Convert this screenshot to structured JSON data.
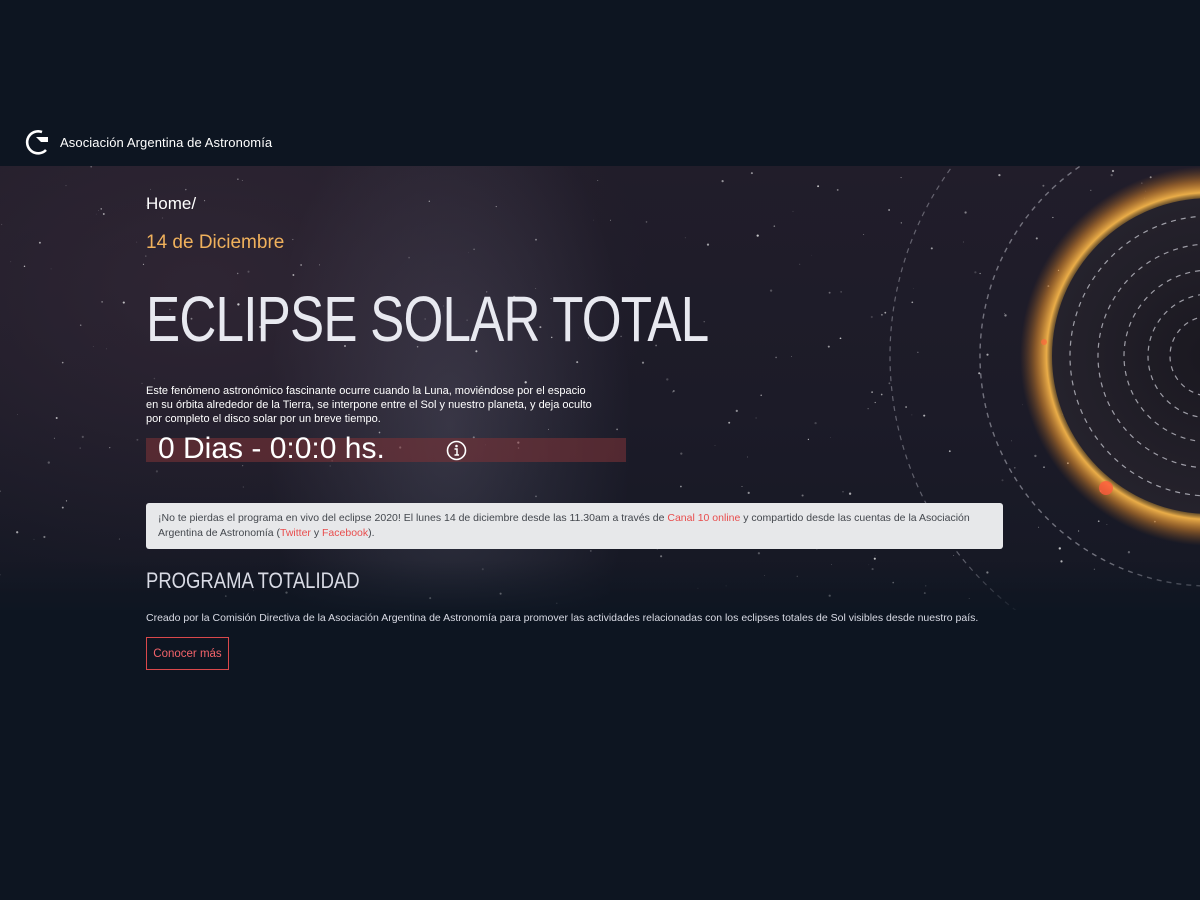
{
  "site": {
    "logo_text": "Asociación Argentina de Astronomía"
  },
  "breadcrumb": {
    "home": "Home",
    "separator": "/"
  },
  "hero": {
    "date": "14 de Diciembre",
    "title": "ECLIPSE SOLAR TOTAL",
    "intro": "Este fenómeno astronómico fascinante ocurre cuando la Luna, moviéndose por el espacio en su órbita alrededor de la Tierra, se interpone entre el Sol y nuestro planeta, y deja oculto por completo el disco solar por un breve tiempo.",
    "countdown": "0 Dias - 0:0:0 hs.",
    "info_icon": "info-circle-icon"
  },
  "notice": {
    "text_before": "¡No te pierdas el programa en vivo del eclipse 2020! El lunes 14 de diciembre desde las 11.30am a través de ",
    "link_canal": "Canal 10 online",
    "text_middle": " y compartido desde las cuentas de la Asociación Argentina de Astronomía (",
    "link_twitter": "Twitter",
    "text_and": " y ",
    "link_facebook": "Facebook",
    "text_end": ")."
  },
  "program": {
    "title": "PROGRAMA TOTALIDAD",
    "description": "Creado por la Comisión Directiva de la Asociación Argentina de Astronomía para promover las actividades relacionadas con los eclipses totales de Sol visibles desde nuestro país.",
    "button_label": "Conocer más"
  },
  "colors": {
    "background": "#0d1521",
    "accent_date": "#f0b15c",
    "link": "#e84d4d",
    "countdown_bar": "#78323780",
    "notice_bg": "#e7e8ea"
  }
}
